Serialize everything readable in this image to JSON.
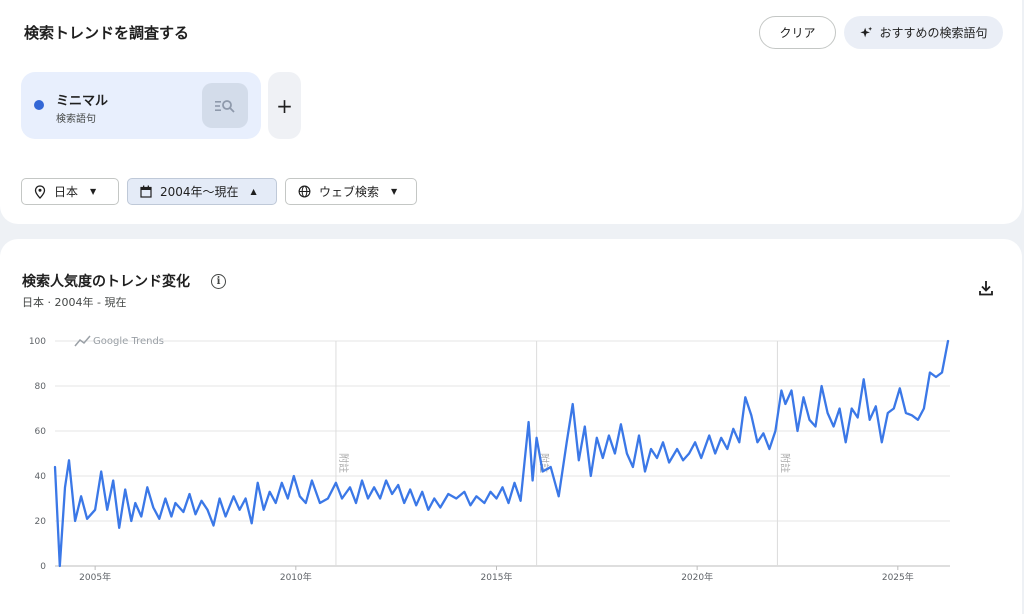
{
  "header": {
    "title": "検索トレンドを調査する",
    "clear_label": "クリア",
    "suggest_label": "おすすめの検索語句"
  },
  "term": {
    "name": "ミニマル",
    "type": "検索語句",
    "color": "#3367d6",
    "add_label": "+"
  },
  "filters": {
    "region": "日本",
    "period": "2004年〜現在",
    "search_type": "ウェブ検索"
  },
  "chart_section": {
    "title": "検索人気度のトレンド変化",
    "info_label": "i",
    "subtitle": "日本 · 2004年 - 現在",
    "watermark": "Google Trends",
    "note_label": "附註"
  },
  "chart_data": {
    "type": "line",
    "title": "",
    "xlabel": "",
    "ylabel": "",
    "ylim": [
      0,
      100
    ],
    "yticks": [
      0,
      20,
      40,
      60,
      80,
      100
    ],
    "xtick_labels": [
      "2005年",
      "2010年",
      "2015年",
      "2020年",
      "2025年"
    ],
    "xticks_years": [
      2005,
      2010,
      2015,
      2020,
      2025
    ],
    "xlim_years": [
      2004.0,
      2026.3
    ],
    "notes_years": [
      2011.0,
      2016.0,
      2022.0
    ],
    "grid": true,
    "series": [
      {
        "color": "#3b78e7",
        "points": [
          [
            2004.0,
            44
          ],
          [
            2004.12,
            0
          ],
          [
            2004.25,
            35
          ],
          [
            2004.35,
            47
          ],
          [
            2004.5,
            20
          ],
          [
            2004.65,
            31
          ],
          [
            2004.8,
            21
          ],
          [
            2005.0,
            25
          ],
          [
            2005.15,
            42
          ],
          [
            2005.3,
            25
          ],
          [
            2005.45,
            38
          ],
          [
            2005.6,
            17
          ],
          [
            2005.75,
            34
          ],
          [
            2005.9,
            20
          ],
          [
            2006.0,
            28
          ],
          [
            2006.15,
            22
          ],
          [
            2006.3,
            35
          ],
          [
            2006.45,
            26
          ],
          [
            2006.6,
            21
          ],
          [
            2006.75,
            30
          ],
          [
            2006.9,
            22
          ],
          [
            2007.0,
            28
          ],
          [
            2007.2,
            24
          ],
          [
            2007.35,
            32
          ],
          [
            2007.5,
            23
          ],
          [
            2007.65,
            29
          ],
          [
            2007.8,
            25
          ],
          [
            2007.95,
            18
          ],
          [
            2008.1,
            30
          ],
          [
            2008.25,
            22
          ],
          [
            2008.45,
            31
          ],
          [
            2008.6,
            25
          ],
          [
            2008.75,
            30
          ],
          [
            2008.9,
            19
          ],
          [
            2009.05,
            37
          ],
          [
            2009.2,
            25
          ],
          [
            2009.35,
            33
          ],
          [
            2009.5,
            28
          ],
          [
            2009.65,
            37
          ],
          [
            2009.8,
            30
          ],
          [
            2009.95,
            40
          ],
          [
            2010.1,
            31
          ],
          [
            2010.25,
            28
          ],
          [
            2010.4,
            38
          ],
          [
            2010.6,
            28
          ],
          [
            2010.8,
            30
          ],
          [
            2011.0,
            37
          ],
          [
            2011.15,
            30
          ],
          [
            2011.35,
            35
          ],
          [
            2011.5,
            28
          ],
          [
            2011.65,
            38
          ],
          [
            2011.8,
            30
          ],
          [
            2011.95,
            35
          ],
          [
            2012.1,
            30
          ],
          [
            2012.25,
            38
          ],
          [
            2012.4,
            32
          ],
          [
            2012.55,
            36
          ],
          [
            2012.7,
            28
          ],
          [
            2012.85,
            34
          ],
          [
            2013.0,
            27
          ],
          [
            2013.15,
            33
          ],
          [
            2013.3,
            25
          ],
          [
            2013.45,
            30
          ],
          [
            2013.6,
            26
          ],
          [
            2013.8,
            32
          ],
          [
            2014.0,
            30
          ],
          [
            2014.2,
            33
          ],
          [
            2014.35,
            27
          ],
          [
            2014.5,
            31
          ],
          [
            2014.7,
            28
          ],
          [
            2014.85,
            33
          ],
          [
            2015.0,
            30
          ],
          [
            2015.15,
            35
          ],
          [
            2015.3,
            28
          ],
          [
            2015.45,
            37
          ],
          [
            2015.6,
            29
          ],
          [
            2015.8,
            64
          ],
          [
            2015.9,
            38
          ],
          [
            2016.0,
            57
          ],
          [
            2016.15,
            42
          ],
          [
            2016.35,
            44
          ],
          [
            2016.55,
            31
          ],
          [
            2016.75,
            55
          ],
          [
            2016.9,
            72
          ],
          [
            2017.05,
            47
          ],
          [
            2017.2,
            62
          ],
          [
            2017.35,
            40
          ],
          [
            2017.5,
            57
          ],
          [
            2017.65,
            48
          ],
          [
            2017.8,
            58
          ],
          [
            2017.95,
            50
          ],
          [
            2018.1,
            63
          ],
          [
            2018.25,
            50
          ],
          [
            2018.4,
            44
          ],
          [
            2018.55,
            58
          ],
          [
            2018.7,
            42
          ],
          [
            2018.85,
            52
          ],
          [
            2019.0,
            48
          ],
          [
            2019.15,
            55
          ],
          [
            2019.3,
            46
          ],
          [
            2019.5,
            52
          ],
          [
            2019.65,
            47
          ],
          [
            2019.8,
            50
          ],
          [
            2019.95,
            55
          ],
          [
            2020.1,
            48
          ],
          [
            2020.3,
            58
          ],
          [
            2020.45,
            50
          ],
          [
            2020.6,
            57
          ],
          [
            2020.75,
            52
          ],
          [
            2020.9,
            61
          ],
          [
            2021.05,
            55
          ],
          [
            2021.2,
            75
          ],
          [
            2021.35,
            67
          ],
          [
            2021.5,
            55
          ],
          [
            2021.65,
            59
          ],
          [
            2021.8,
            52
          ],
          [
            2021.95,
            60
          ],
          [
            2022.1,
            78
          ],
          [
            2022.2,
            72
          ],
          [
            2022.35,
            78
          ],
          [
            2022.5,
            60
          ],
          [
            2022.65,
            75
          ],
          [
            2022.8,
            65
          ],
          [
            2022.95,
            62
          ],
          [
            2023.1,
            80
          ],
          [
            2023.25,
            68
          ],
          [
            2023.4,
            62
          ],
          [
            2023.55,
            70
          ],
          [
            2023.7,
            55
          ],
          [
            2023.85,
            70
          ],
          [
            2024.0,
            66
          ],
          [
            2024.15,
            83
          ],
          [
            2024.3,
            65
          ],
          [
            2024.45,
            71
          ],
          [
            2024.6,
            55
          ],
          [
            2024.75,
            68
          ],
          [
            2024.9,
            70
          ],
          [
            2025.05,
            79
          ],
          [
            2025.2,
            68
          ],
          [
            2025.35,
            67
          ],
          [
            2025.5,
            65
          ],
          [
            2025.65,
            70
          ],
          [
            2025.8,
            86
          ],
          [
            2025.95,
            84
          ],
          [
            2026.1,
            86
          ],
          [
            2026.25,
            100
          ]
        ]
      }
    ]
  }
}
